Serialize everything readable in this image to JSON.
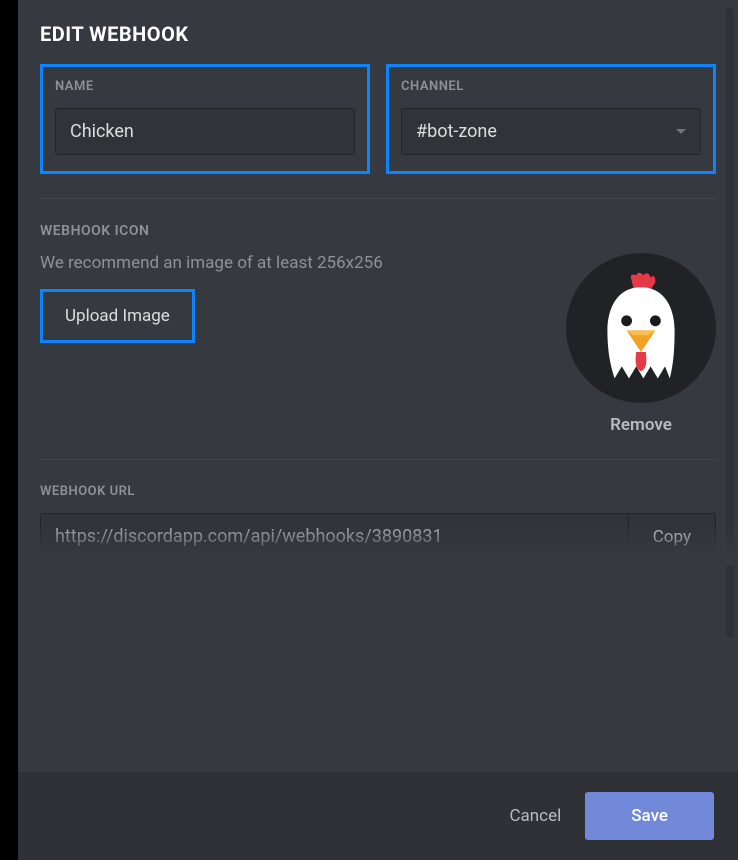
{
  "modal": {
    "title": "EDIT WEBHOOK"
  },
  "nameField": {
    "label": "NAME",
    "value": "Chicken"
  },
  "channelField": {
    "label": "CHANNEL",
    "value": "#bot-zone"
  },
  "iconSection": {
    "label": "WEBHOOK ICON",
    "help": "We recommend an image of at least 256x256",
    "uploadLabel": "Upload Image",
    "removeLabel": "Remove",
    "avatarName": "chicken-avatar"
  },
  "urlSection": {
    "label": "WEBHOOK URL",
    "value": "https://discordapp.com/api/webhooks/3890831",
    "copyLabel": "Copy"
  },
  "footer": {
    "cancel": "Cancel",
    "save": "Save"
  },
  "colors": {
    "highlight": "#0a84ff",
    "primary": "#7289da"
  }
}
